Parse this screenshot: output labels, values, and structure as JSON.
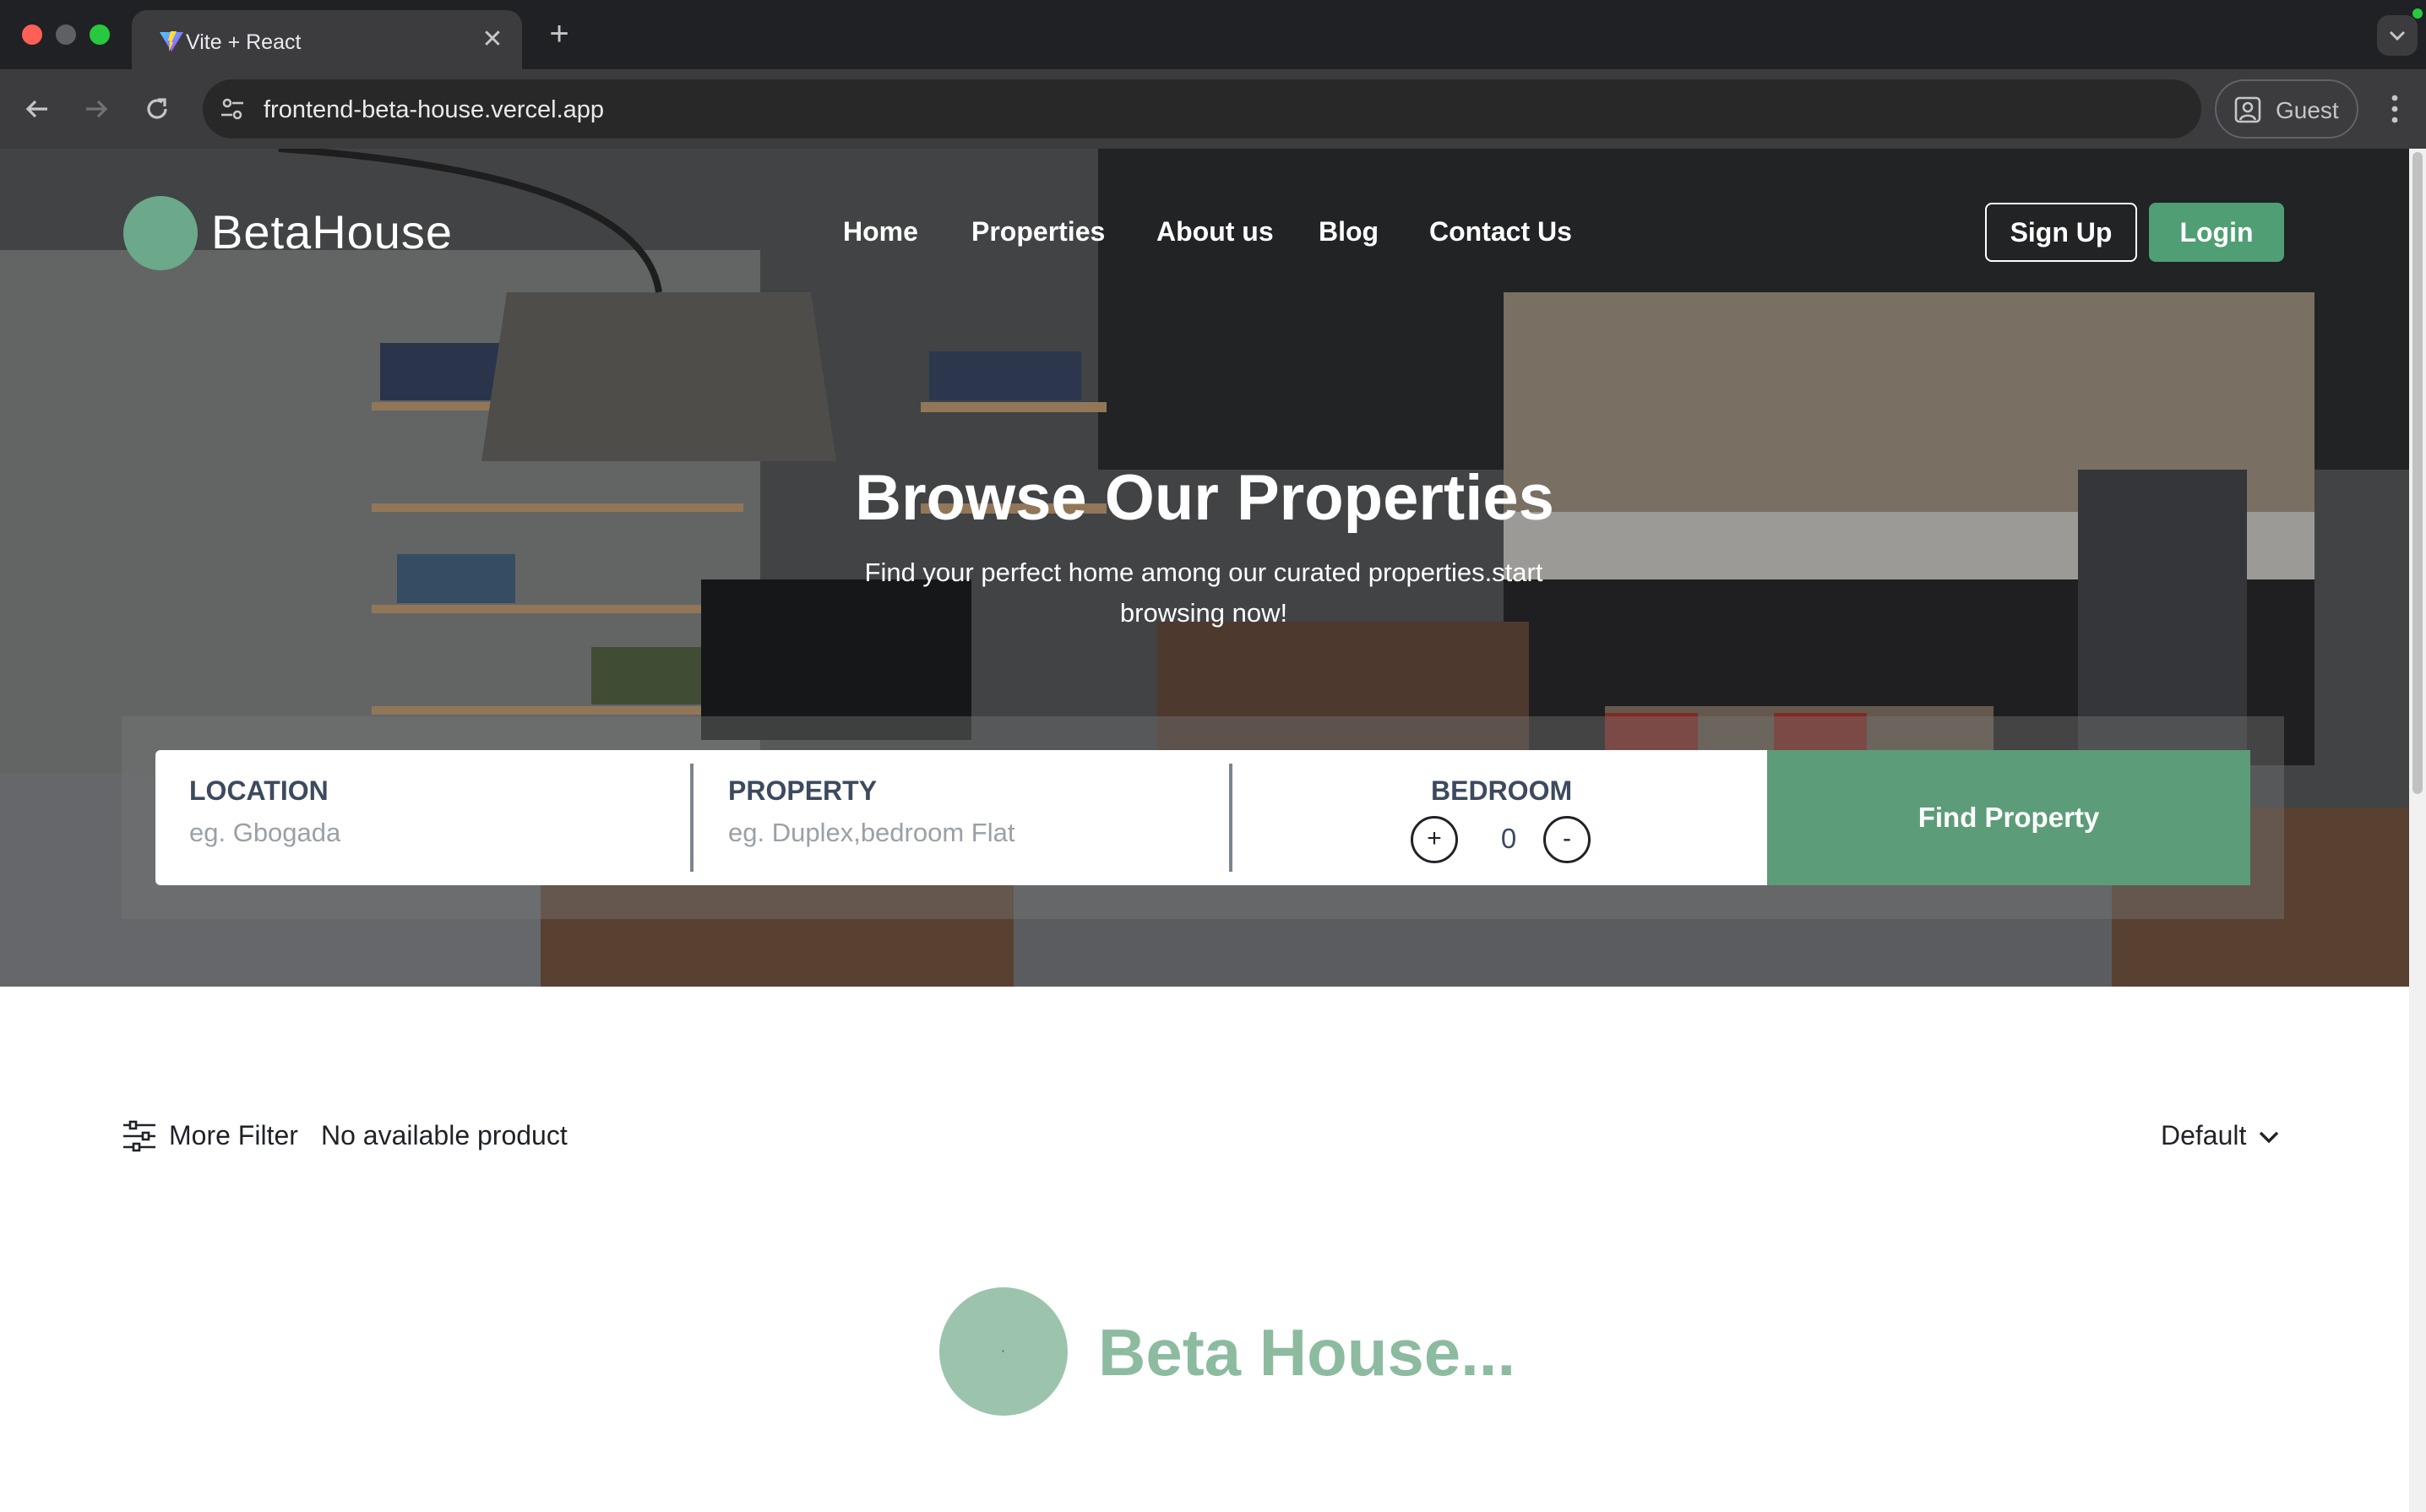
{
  "browser": {
    "tab_title": "Vite + React",
    "url": "frontend-beta-house.vercel.app",
    "profile_label": "Guest"
  },
  "site": {
    "logo_text": "BetaHouse",
    "nav": [
      "Home",
      "Properties",
      "About us",
      "Blog",
      "Contact Us"
    ],
    "signup_label": "Sign Up",
    "login_label": "Login"
  },
  "hero": {
    "title": "Browse Our Properties",
    "subtitle": "Find your perfect home among our curated properties.start browsing now!"
  },
  "search": {
    "location_label": "LOCATION",
    "location_placeholder": "eg. Gbogada",
    "property_label": "PROPERTY",
    "property_placeholder": "eg. Duplex,bedroom Flat",
    "bedroom_label": "BEDROOM",
    "bedroom_plus": "+",
    "bedroom_value": "0",
    "bedroom_minus": "-",
    "find_label": "Find Property"
  },
  "listing": {
    "filter_label": "More Filter",
    "count_text": "No available product",
    "sort_label": "Default"
  },
  "loader": {
    "text": "Beta House..."
  },
  "colors": {
    "brand_green": "#4f9e74",
    "find_green": "#5c9c78",
    "loader_green": "#8cbba0"
  }
}
